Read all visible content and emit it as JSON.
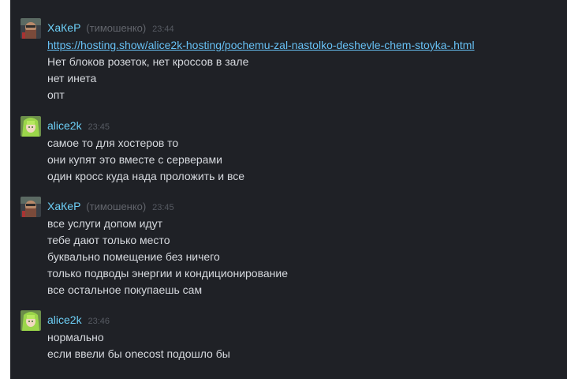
{
  "messages": [
    {
      "avatar": "user-avatar-hacker",
      "name": "ХаКеР",
      "nick": "(тимошенко)",
      "time": "23:44",
      "link": "https://hosting.show/alice2k-hosting/pochemu-zal-nastolko-deshevle-chem-stoyka-.html",
      "lines": [
        "Нет блоков розеток, нет кроссов в зале",
        "нет инета",
        "опт"
      ]
    },
    {
      "avatar": "user-avatar-alice2k",
      "name": "alice2k",
      "time": "23:45",
      "lines": [
        "самое то для хостеров то",
        "они купят это вместе с серверами",
        "один кросс куда нада проложить и все"
      ]
    },
    {
      "avatar": "user-avatar-hacker",
      "name": "ХаКеР",
      "nick": "(тимошенко)",
      "time": "23:45",
      "lines": [
        "все услуги допом идут",
        "тебе дают только место",
        "буквально помещение без ничего",
        "только подводы энергии и кондиционирование",
        "все остальное покупаешь сам"
      ]
    },
    {
      "avatar": "user-avatar-alice2k",
      "name": "alice2k",
      "time": "23:46",
      "lines": [
        "нормально",
        "если ввели бы onecost подошло бы"
      ]
    }
  ],
  "colors": {
    "background": "#1f2126",
    "name": "#6dcff6",
    "text": "#d6d9de",
    "link": "#67c1f5"
  }
}
